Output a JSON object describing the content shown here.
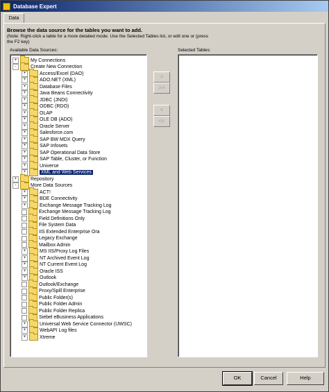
{
  "window": {
    "title": "Database Expert"
  },
  "tab": {
    "label": "Data"
  },
  "heading": "Browse the data source for the tables you want to add.",
  "instructions": "(Note: Right-click a table for a more detailed mode. Use the Selected Tables list, or edit one or (press the F2 key)",
  "available_label": "Available Data Sources:",
  "selected_label": "Selected Tables:",
  "tree": [
    {
      "label": "My Connections",
      "expand": "+",
      "level": 0
    },
    {
      "label": "Create New Connection",
      "expand": "-",
      "level": 0
    },
    {
      "label": "Access/Excel (DAO)",
      "expand": "+",
      "level": 1
    },
    {
      "label": "ADO.NET (XML)",
      "expand": "+",
      "level": 1
    },
    {
      "label": "Database Files",
      "expand": "+",
      "level": 1
    },
    {
      "label": "Java Beans Connectivity",
      "expand": "+",
      "level": 1
    },
    {
      "label": "JDBC (JNDI)",
      "expand": "+",
      "level": 1
    },
    {
      "label": "ODBC (RDO)",
      "expand": "+",
      "level": 1
    },
    {
      "label": "OLAP",
      "expand": "+",
      "level": 1
    },
    {
      "label": "OLE DB (ADO)",
      "expand": "+",
      "level": 1
    },
    {
      "label": "Oracle Server",
      "expand": "+",
      "level": 1
    },
    {
      "label": "Salesforce.com",
      "expand": "+",
      "level": 1
    },
    {
      "label": "SAP BW MDX Query",
      "expand": "+",
      "level": 1
    },
    {
      "label": "SAP Infosets",
      "expand": "+",
      "level": 1
    },
    {
      "label": "SAP Operational Data Store",
      "expand": "+",
      "level": 1
    },
    {
      "label": "SAP Table, Cluster, or Function",
      "expand": "+",
      "level": 1
    },
    {
      "label": "Universe",
      "expand": "+",
      "level": 1
    },
    {
      "label": "XML and Web Services",
      "expand": "+",
      "level": 1,
      "selected": true
    },
    {
      "label": "Repository",
      "expand": "+",
      "level": 0
    },
    {
      "label": "More Data Sources",
      "expand": "-",
      "level": 0
    },
    {
      "label": "ACT!",
      "expand": "+",
      "level": 1
    },
    {
      "label": "BDE Connectivity",
      "expand": "+",
      "level": 1
    },
    {
      "label": "Exchange Message Tracking Log",
      "expand": "+",
      "level": 1
    },
    {
      "label": "Exchange Message Tracking Log",
      "expand": "",
      "level": 1
    },
    {
      "label": "Field Definitions Only",
      "expand": "",
      "level": 1
    },
    {
      "label": "File System Data",
      "expand": "",
      "level": 1
    },
    {
      "label": "IIS Extended Enterprise Ora",
      "expand": "",
      "level": 1
    },
    {
      "label": "Legacy Exchange",
      "expand": "",
      "level": 1
    },
    {
      "label": "Mailbox Admin",
      "expand": "",
      "level": 1
    },
    {
      "label": "MS IIS/Proxy Log Files",
      "expand": "+",
      "level": 1
    },
    {
      "label": "NT Archived Event Log",
      "expand": "+",
      "level": 1
    },
    {
      "label": "NT Current Event Log",
      "expand": "+",
      "level": 1
    },
    {
      "label": "Oracle ISS",
      "expand": "+",
      "level": 1
    },
    {
      "label": "Outlook",
      "expand": "+",
      "level": 1
    },
    {
      "label": "Outlook/Exchange",
      "expand": "",
      "level": 1
    },
    {
      "label": "Proxy/Spill Enterprise",
      "expand": "",
      "level": 1
    },
    {
      "label": "Public Folder(s)",
      "expand": "",
      "level": 1
    },
    {
      "label": "Public Folder Admin",
      "expand": "",
      "level": 1
    },
    {
      "label": "Public Folder Replica",
      "expand": "",
      "level": 1
    },
    {
      "label": "Siebel eBusiness Applications",
      "expand": "",
      "level": 1
    },
    {
      "label": "Universal Web Service Connector (UWSC)",
      "expand": "+",
      "level": 1
    },
    {
      "label": "WebAPI Log files",
      "expand": "+",
      "level": 1
    },
    {
      "label": "Xtreme",
      "expand": "+",
      "level": 1
    }
  ],
  "buttons": {
    "add_one": ">",
    "add_all": ">>",
    "remove_one": "<",
    "remove_all": "<<",
    "ok": "OK",
    "cancel": "Cancel",
    "help": "Help"
  }
}
